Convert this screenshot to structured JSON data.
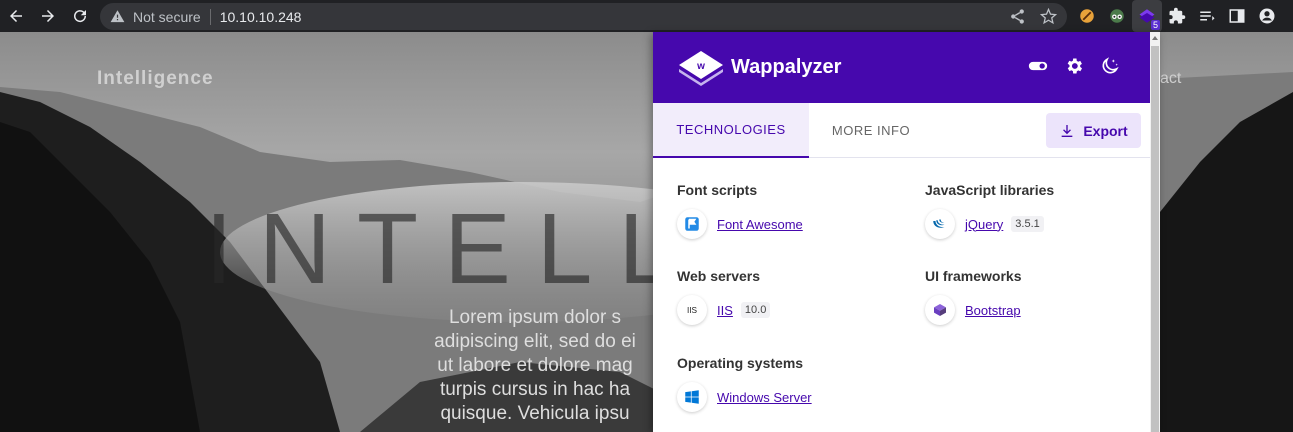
{
  "browser": {
    "security_label": "Not secure",
    "url": "10.10.10.248",
    "extension_badge": "5"
  },
  "site": {
    "logo": "Intelligence",
    "nav_contact": "act",
    "hero_title": "INTELLI",
    "hero_lines": [
      "Lorem ipsum dolor s",
      "adipiscing elit, sed do ei",
      "ut labore et dolore mag",
      "turpis cursus in hac ha",
      "quisque. Vehicula ipsu"
    ]
  },
  "wappalyzer": {
    "brand": "Wappalyzer",
    "tabs": [
      {
        "label": "TECHNOLOGIES",
        "active": true
      },
      {
        "label": "MORE INFO",
        "active": false
      }
    ],
    "export_label": "Export",
    "accent_color": "#4608ad",
    "categories": [
      {
        "title": "Font scripts",
        "items": [
          {
            "name": "Font Awesome",
            "icon": "font-awesome-icon",
            "version": ""
          }
        ]
      },
      {
        "title": "JavaScript libraries",
        "items": [
          {
            "name": "jQuery",
            "icon": "jquery-icon",
            "version": "3.5.1"
          }
        ]
      },
      {
        "title": "Web servers",
        "items": [
          {
            "name": "IIS",
            "icon": "iis-icon",
            "version": "10.0"
          }
        ]
      },
      {
        "title": "UI frameworks",
        "items": [
          {
            "name": "Bootstrap",
            "icon": "bootstrap-icon",
            "version": ""
          }
        ]
      },
      {
        "title": "Operating systems",
        "items": [
          {
            "name": "Windows Server",
            "icon": "windows-icon",
            "version": ""
          }
        ]
      }
    ]
  }
}
